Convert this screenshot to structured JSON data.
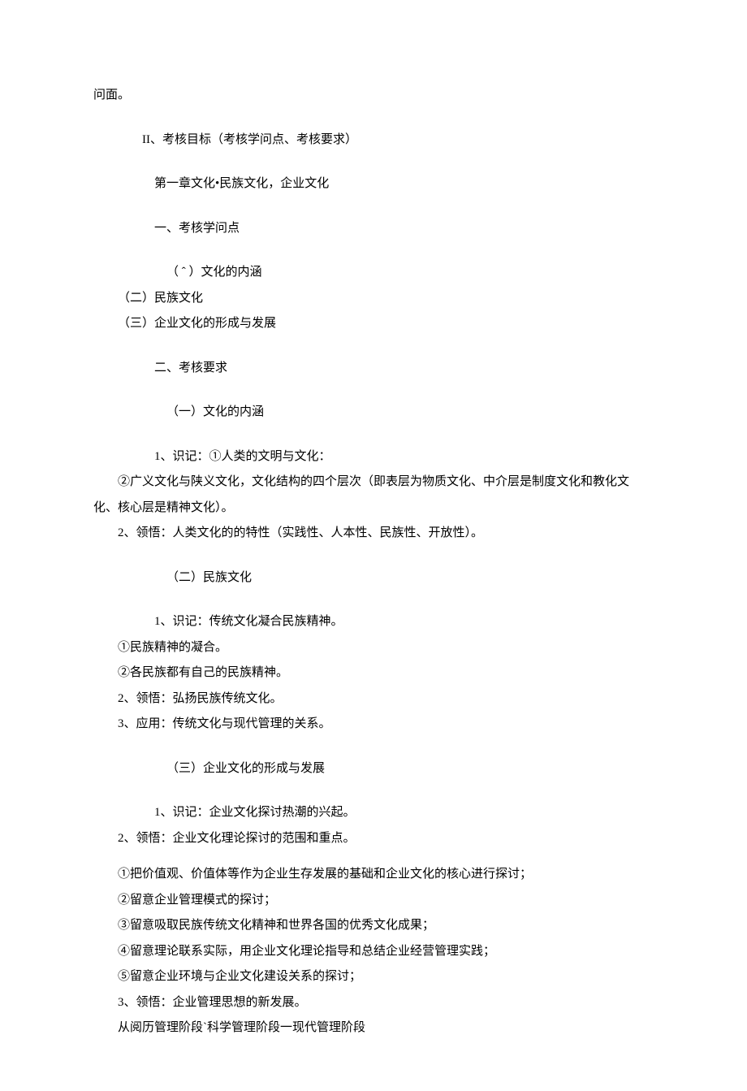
{
  "l0": "问面。",
  "l1": "II、考核目标（考核学问点、考核要求）",
  "l2": "第一章文化•民族文化，企业文化",
  "l3": "一、考核学问点",
  "l4": "（ ˆ ）文化的内涵",
  "l5": "（二）民族文化",
  "l6": "（三）企业文化的形成与发展",
  "l7": "二、考核要求",
  "l8": "（一）文化的内涵",
  "l9": "1、识记：①人类的文明与文化：",
  "l10": "②广义文化与陕义文化，文化结构的四个层次（即表层为物质文化、中介层是制度文化和教化文",
  "l11": "化、核心层是精神文化）。",
  "l12": "2、领悟：人类文化的的特性（实践性、人本性、民族性、开放性）。",
  "l13": "（二）民族文化",
  "l14": "1、识记：传统文化凝合民族精神。",
  "l15": "①民族精神的凝合。",
  "l16": "②各民族都有自己的民族精神。",
  "l17": "2、领悟：弘扬民族传统文化。",
  "l18": "3、应用：传统文化与现代管理的关系。",
  "l19": "（三）企业文化的形成与发展",
  "l20": "1、识记：企业文化探讨热潮的兴起。",
  "l21": "2、领悟：企业文化理论探讨的范围和重点。",
  "l22": "①把价值观、价值体等作为企业生存发展的基础和企业文化的核心进行探讨；",
  "l23": "②留意企业管理模式的探讨；",
  "l24": "③留意吸取民族传统文化精神和世界各国的优秀文化成果；",
  "l25": "④留意理论联系实际，用企业文化理论指导和总结企业经营管理实践；",
  "l26": "⑤留意企业环境与企业文化建设关系的探讨；",
  "l27": "3、领悟：企业管理思想的新发展。",
  "l28": "从阅历管理阶段`科学管理阶段一现代管理阶段"
}
